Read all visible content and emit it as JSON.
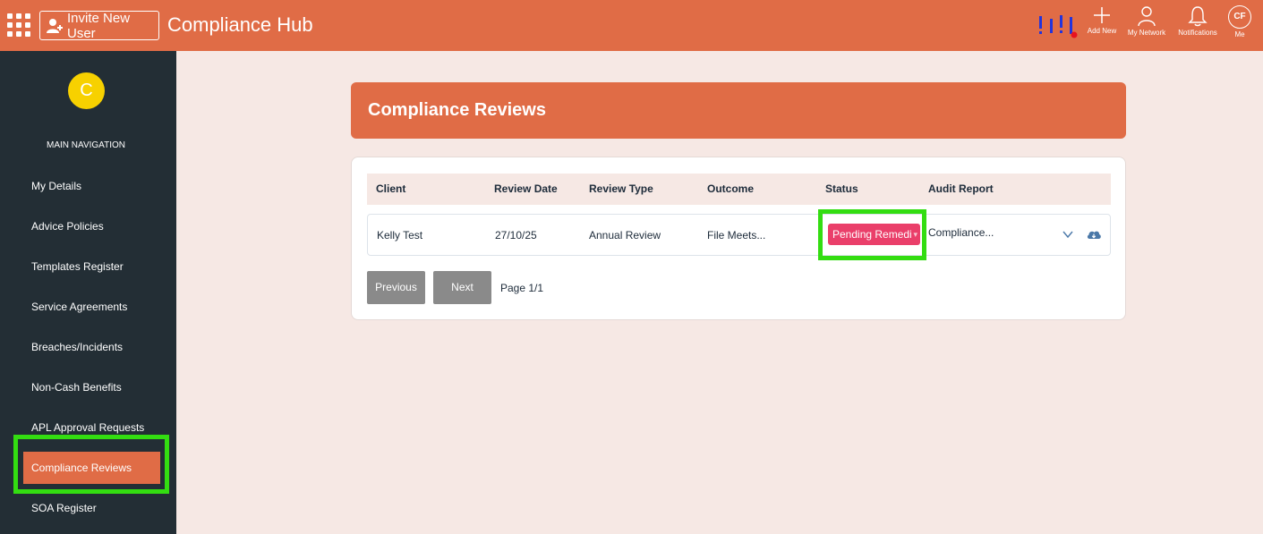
{
  "topbar": {
    "invite_label": "Invite New User",
    "app_title": "Compliance Hub",
    "actions": [
      {
        "label": "Add New",
        "icon": "plus-icon"
      },
      {
        "label": "My Network",
        "icon": "person-icon"
      },
      {
        "label": "Notifications",
        "icon": "bell-icon"
      },
      {
        "label": "Me",
        "initials": "CF",
        "icon": "avatar-icon"
      }
    ]
  },
  "sidebar": {
    "avatar_initial": "C",
    "heading": "MAIN NAVIGATION",
    "items": [
      {
        "label": "My Details"
      },
      {
        "label": "Advice Policies"
      },
      {
        "label": "Templates Register"
      },
      {
        "label": "Service Agreements"
      },
      {
        "label": "Breaches/Incidents"
      },
      {
        "label": "Non-Cash Benefits"
      },
      {
        "label": "APL Approval Requests"
      },
      {
        "label": "Compliance Reviews",
        "active": true
      },
      {
        "label": "SOA Register"
      }
    ]
  },
  "main": {
    "title": "Compliance Reviews",
    "columns": [
      "Client",
      "Review Date",
      "Review Type",
      "Outcome",
      "Status",
      "Audit Report"
    ],
    "rows": [
      {
        "client": "Kelly Test",
        "review_date": "27/10/25",
        "review_type": "Annual Review",
        "outcome": "File Meets...",
        "status": "Pending Remedi",
        "audit_report": "Compliance..."
      }
    ],
    "pagination": {
      "previous_label": "Previous",
      "next_label": "Next",
      "page_info": "Page 1/1"
    }
  },
  "colors": {
    "accent": "#e06c46",
    "sidebar_bg": "#232e35",
    "page_bg": "#f6e8e4",
    "status_pending": "#ea3f6a",
    "highlight": "#33dd11",
    "avatar": "#f7d100"
  }
}
